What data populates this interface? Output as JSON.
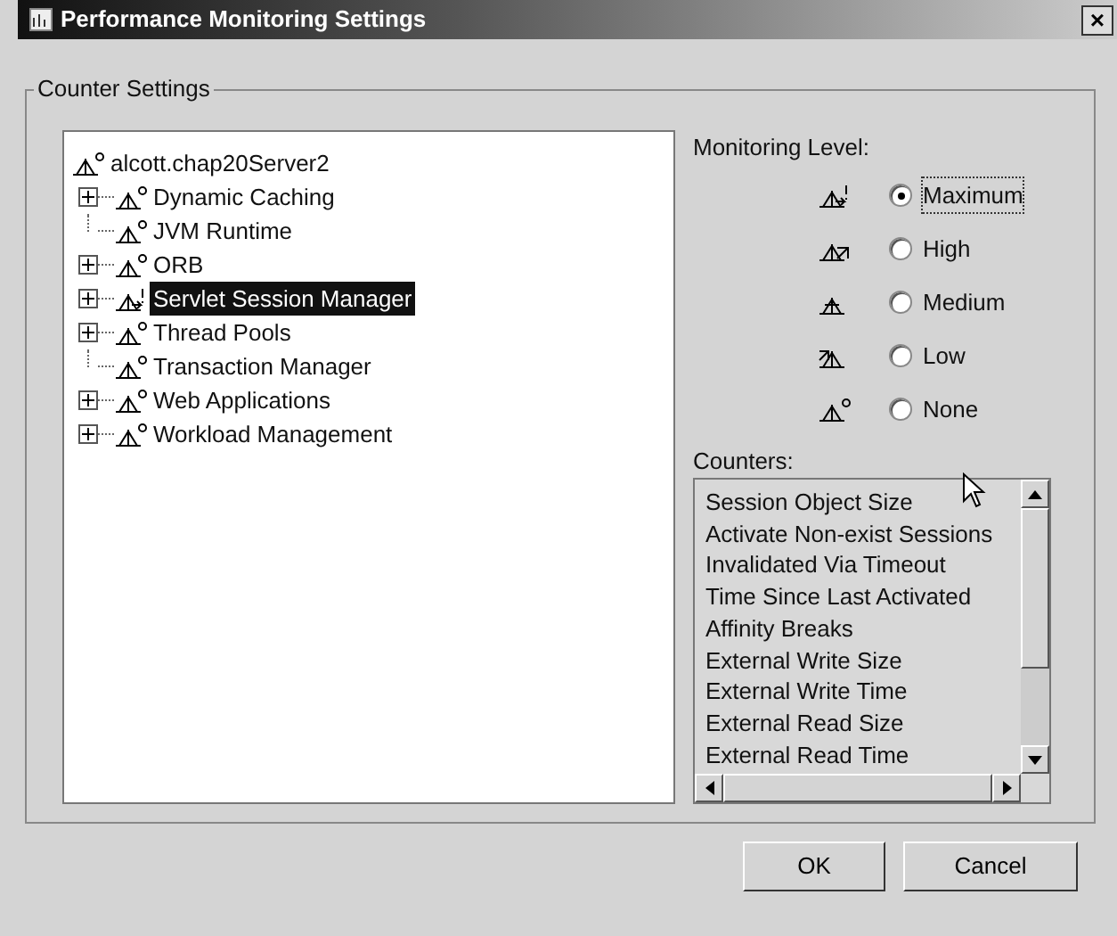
{
  "window": {
    "title": "Performance Monitoring Settings",
    "close": "×"
  },
  "group": {
    "legend": "Counter Settings"
  },
  "tree": {
    "root": {
      "label": "alcott.chap20Server2",
      "kind": "none",
      "selected": false
    },
    "children": [
      {
        "label": "Dynamic Caching",
        "expandable": true,
        "kind": "none",
        "selected": false
      },
      {
        "label": "JVM Runtime",
        "expandable": false,
        "kind": "none",
        "selected": false
      },
      {
        "label": "ORB",
        "expandable": true,
        "kind": "none",
        "selected": false
      },
      {
        "label": "Servlet Session Manager",
        "expandable": true,
        "kind": "maximum",
        "selected": true
      },
      {
        "label": "Thread Pools",
        "expandable": true,
        "kind": "none",
        "selected": false
      },
      {
        "label": "Transaction Manager",
        "expandable": false,
        "kind": "none",
        "selected": false
      },
      {
        "label": "Web Applications",
        "expandable": true,
        "kind": "none",
        "selected": false
      },
      {
        "label": "Workload Management",
        "expandable": true,
        "kind": "none",
        "selected": false
      }
    ]
  },
  "monitoring_level": {
    "label": "Monitoring Level:",
    "options": [
      {
        "label": "Maximum",
        "kind": "maximum",
        "selected": true
      },
      {
        "label": "High",
        "kind": "high",
        "selected": false
      },
      {
        "label": "Medium",
        "kind": "medium",
        "selected": false
      },
      {
        "label": "Low",
        "kind": "low",
        "selected": false
      },
      {
        "label": "None",
        "kind": "none",
        "selected": false
      }
    ]
  },
  "counters": {
    "label": "Counters:",
    "items": [
      "Session Object Size",
      "Activate Non-exist Sessions",
      "Invalidated Via Timeout",
      "Time Since Last Activated",
      "Affinity Breaks",
      "External Write Size",
      "External Write Time",
      "External Read Size",
      "External Read Time"
    ]
  },
  "buttons": [
    "OK",
    "Cancel"
  ]
}
